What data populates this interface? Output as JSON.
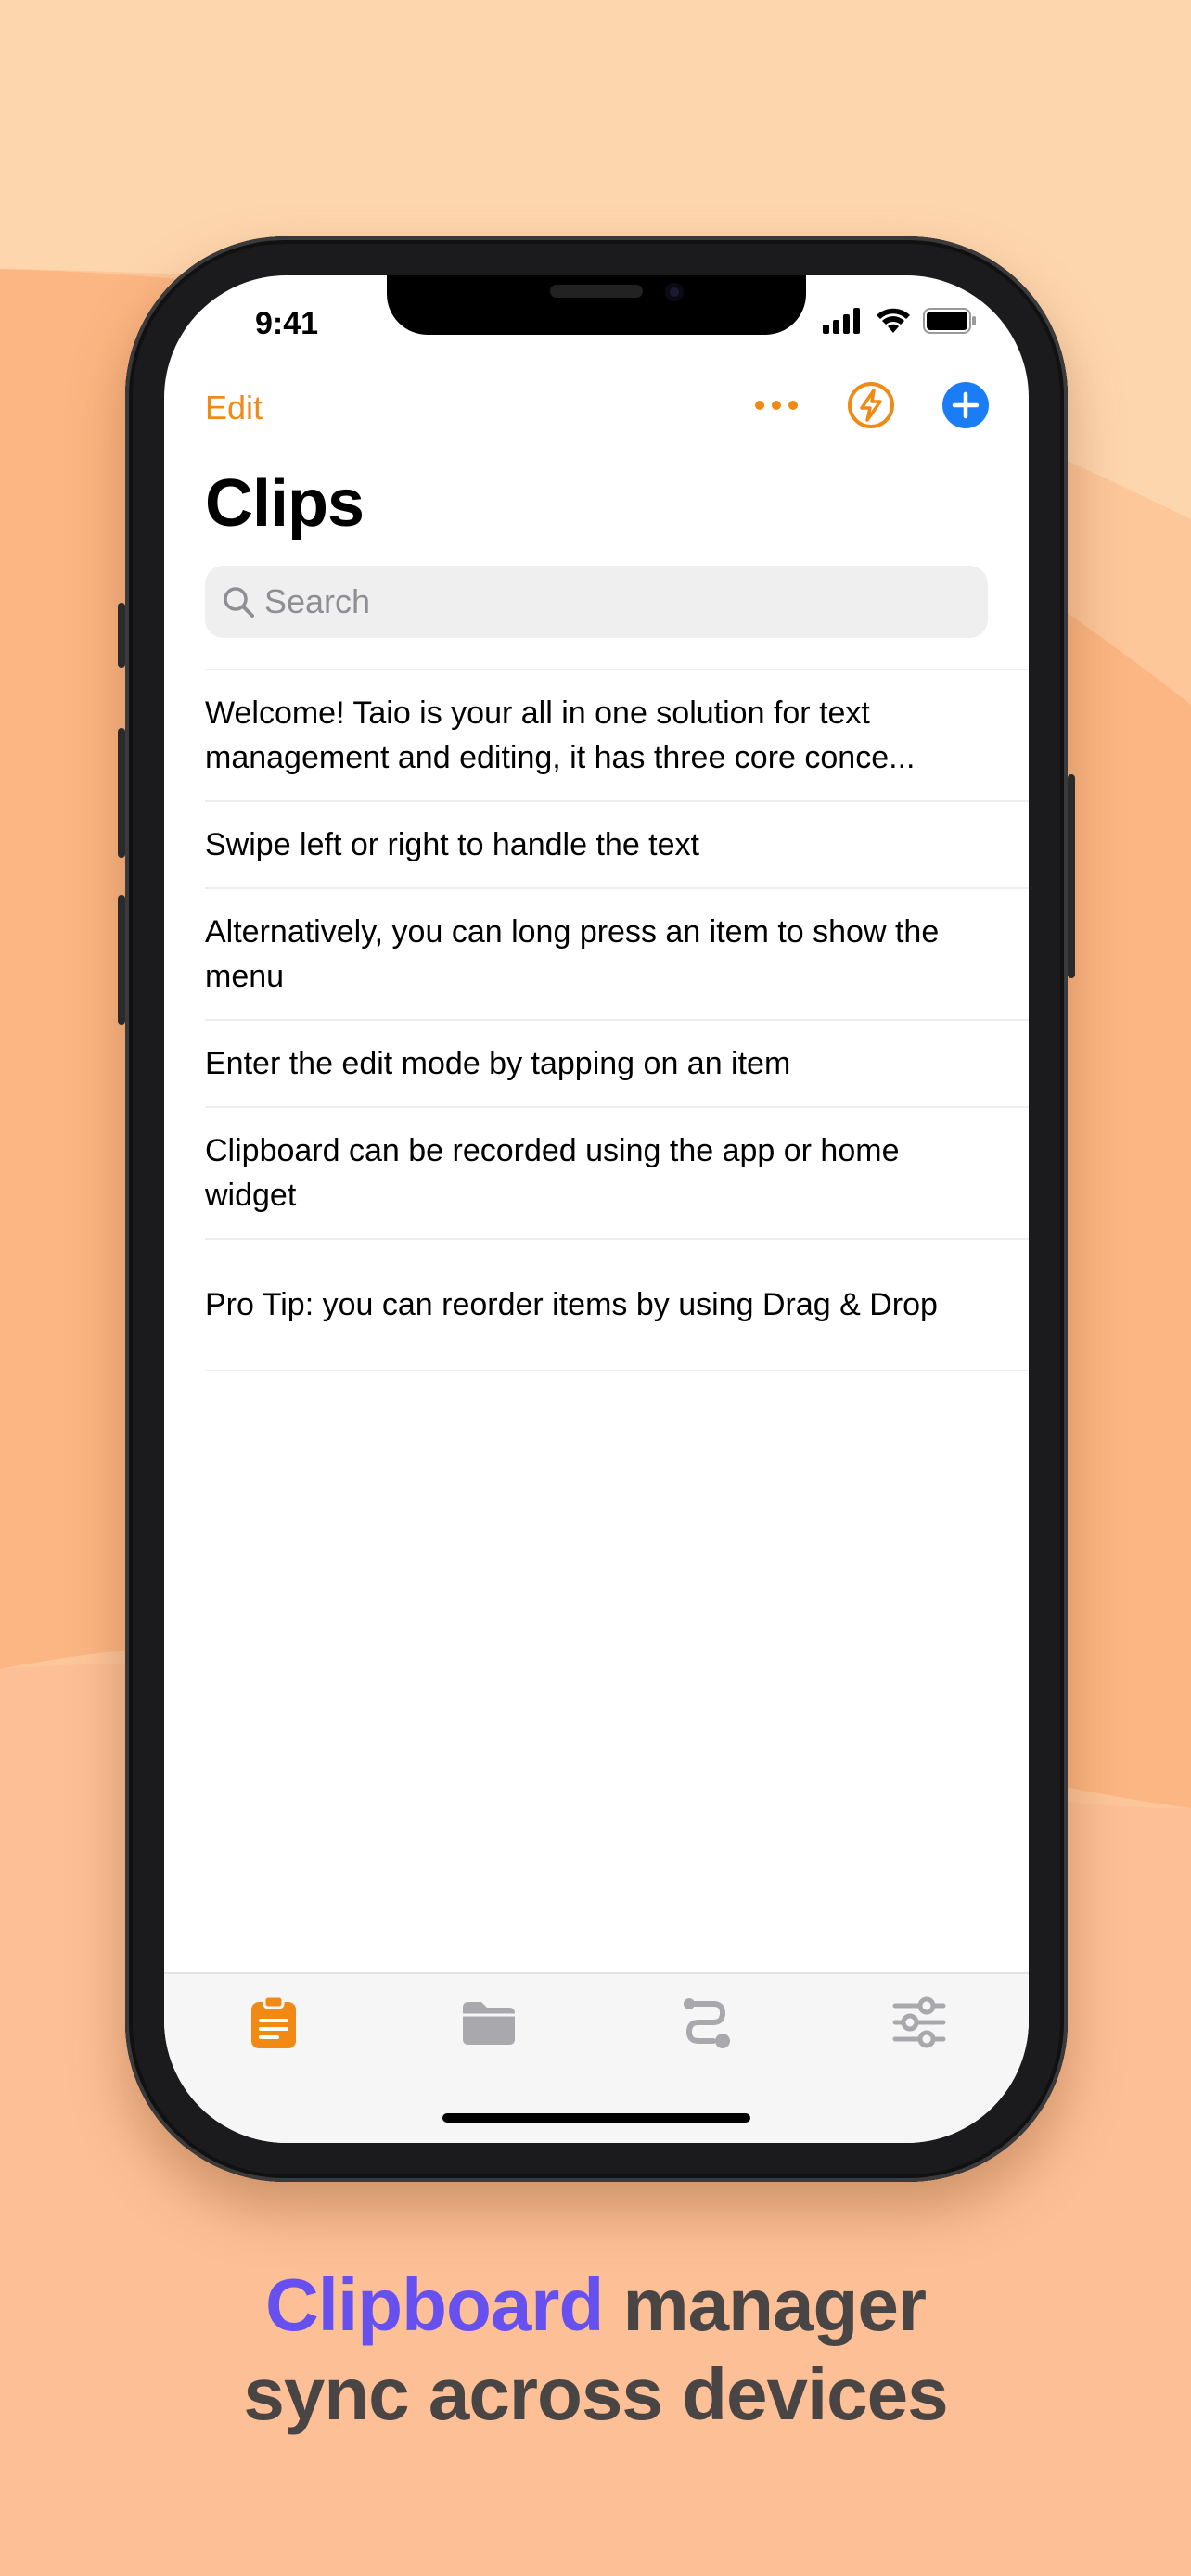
{
  "status": {
    "time": "9:41"
  },
  "nav": {
    "edit_label": "Edit",
    "title": "Clips"
  },
  "search": {
    "placeholder": "Search"
  },
  "clips": [
    "Welcome! Taio is your all in one solution for text management and editing, it has three core conce...",
    "Swipe left or right to handle the text",
    "Alternatively, you can long press an item to show the menu",
    "Enter the edit mode by tapping on an item",
    "Clipboard can be recorded using the app or home widget",
    "Pro Tip: you can reorder items by using Drag & Drop"
  ],
  "tabs": [
    {
      "icon": "clipboard-icon",
      "active": true
    },
    {
      "icon": "folder-icon",
      "active": false
    },
    {
      "icon": "workflow-icon",
      "active": false
    },
    {
      "icon": "settings-sliders-icon",
      "active": false
    }
  ],
  "caption": {
    "highlight": "Clipboard",
    "line1_rest": " manager",
    "line2": "sync across devices"
  },
  "colors": {
    "accent_orange": "#f08a14",
    "accent_blue": "#1a7df5",
    "caption_purple": "#6750f0",
    "background": "#fdc79a"
  }
}
